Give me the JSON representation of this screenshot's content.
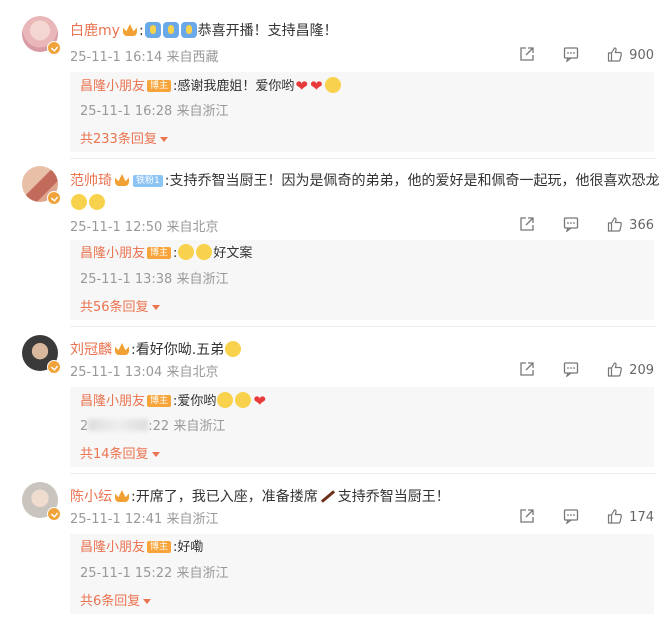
{
  "comments": [
    {
      "user": "白鹿my",
      "text": ":🙋🙋🙋恭喜开播！支持昌隆！",
      "text_plain": "恭喜开播！支持昌隆！",
      "meta": "25-11-1 16:14 来自西藏",
      "likes": "900",
      "reply": {
        "user": "昌隆小朋友",
        "badge": "博主",
        "text": ":感谢我鹿姐！爱你哟",
        "meta": "25-11-1 16:28 来自浙江"
      },
      "more": "共233条回复"
    },
    {
      "user": "范帅琦",
      "fan_badge": "铁粉1",
      "text": ":支持乔智当厨王！因为是佩奇的弟弟，他的爱好是和佩奇一起玩，他很喜欢恐龙",
      "meta": "25-11-1 12:50 来自北京",
      "likes": "366",
      "reply": {
        "user": "昌隆小朋友",
        "badge": "博主",
        "text": "好文案",
        "meta": "25-11-1 13:38 来自浙江"
      },
      "more": "共56条回复"
    },
    {
      "user": "刘冠麟",
      "text": ":看好你呦.五弟",
      "meta": "25-11-1 13:04 来自北京",
      "likes": "209",
      "reply": {
        "user": "昌隆小朋友",
        "badge": "博主",
        "text": ":爱你哟",
        "meta_prefix": "2",
        "meta": ":22 来自浙江"
      },
      "more": "共14条回复"
    },
    {
      "user": "陈小纭",
      "text": ":开席了，我已入座，准备搂席",
      "text_after": "支持乔智当厨王！",
      "meta": "25-11-1 12:41 来自浙江",
      "likes": "174",
      "reply": {
        "user": "昌隆小朋友",
        "badge": "博主",
        "text": ":好嘞",
        "meta": "25-11-1 15:22 来自浙江"
      },
      "more": "共6条回复"
    }
  ],
  "icons": {
    "share": "share-icon",
    "comment": "comment-icon",
    "like": "thumbs-up-icon"
  },
  "colors": {
    "username": "#eb7350",
    "meta": "#999999",
    "reply_bg": "#f7f7f7"
  }
}
